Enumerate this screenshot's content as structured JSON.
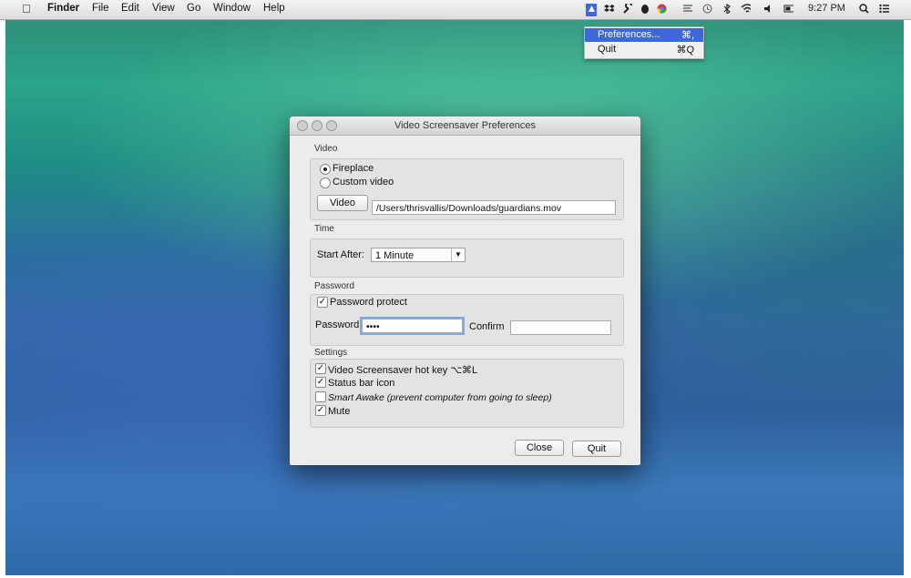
{
  "menubar": {
    "apple": "",
    "items": [
      "Finder",
      "File",
      "Edit",
      "View",
      "Go",
      "Window",
      "Help"
    ],
    "clock": "9:27 PM"
  },
  "status_icons": [
    "screensaver-status-icon",
    "dropbox-icon",
    "wrench-icon",
    "evernote-icon",
    "chrome-icon",
    "cast-icon",
    "time-machine-icon",
    "bluetooth-icon",
    "wifi-icon",
    "volume-icon",
    "battery-icon",
    "spotlight-icon",
    "list-icon"
  ],
  "dropdown": {
    "items": [
      {
        "label": "Preferences...",
        "shortcut": "⌘,"
      },
      {
        "label": "Quit",
        "shortcut": "⌘Q"
      }
    ]
  },
  "window": {
    "title": "Video Screensaver Preferences",
    "video": {
      "section": "Video",
      "fireplace": "Fireplace",
      "custom_video": "Custom video",
      "video_button": "Video",
      "path": "/Users/thrisvallis/Downloads/guardians.mov"
    },
    "time": {
      "section": "Time",
      "start_after_label": "Start After:",
      "start_after_value": "1 Minute"
    },
    "password": {
      "section": "Password",
      "protect_label": "Password protect",
      "password_label": "Password",
      "password_value": "••••",
      "confirm_label": "Confirm",
      "confirm_value": ""
    },
    "settings": {
      "section": "Settings",
      "hotkey": "Video Screensaver hot key  ⌥⌘L",
      "status_bar": "Status bar icon",
      "smart_awake": "Smart Awake (prevent computer from going to sleep)",
      "mute": "Mute"
    },
    "buttons": {
      "close": "Close",
      "quit": "Quit"
    }
  },
  "colors": {
    "highlight": "#3d68d8",
    "window_bg": "#ececec"
  }
}
